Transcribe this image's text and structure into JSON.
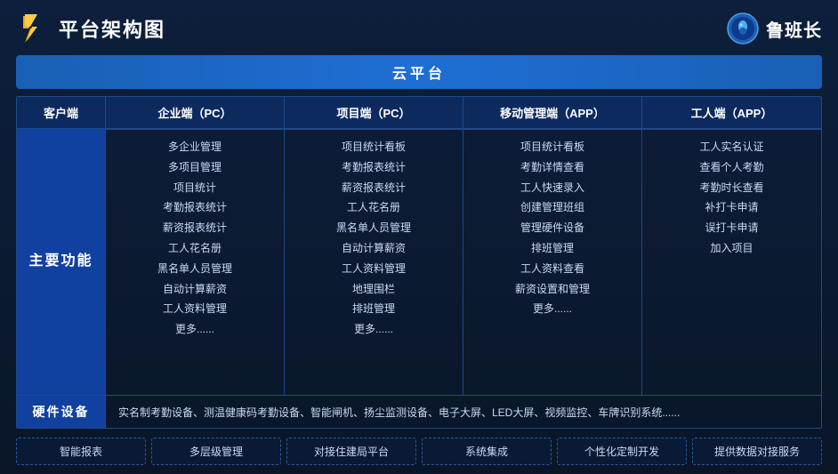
{
  "header": {
    "title": "平台架构图",
    "brand_name": "鲁班长"
  },
  "cloud_bar": "云平台",
  "columns": {
    "client": "客户端",
    "enterprise": "企业端（PC）",
    "project_pc": "项目端（PC）",
    "mobile_app": "移动管理端（APP）",
    "worker_app": "工人端（APP）"
  },
  "row_label": "主要功能",
  "enterprise_features": [
    "多企业管理",
    "多项目管理",
    "项目统计",
    "考勤报表统计",
    "薪资报表统计",
    "工人花名册",
    "黑名单人员管理",
    "自动计算薪资",
    "工人资料管理",
    "更多......"
  ],
  "project_features": [
    "项目统计看板",
    "考勤报表统计",
    "薪资报表统计",
    "工人花名册",
    "黑名单人员管理",
    "自动计算薪资",
    "工人资料管理",
    "地理围栏",
    "排班管理",
    "更多......"
  ],
  "mobile_features": [
    "项目统计看板",
    "考勤详情查看",
    "工人快速录入",
    "创建管理班组",
    "管理硬件设备",
    "排班管理",
    "工人资料查看",
    "薪资设置和管理",
    "更多......"
  ],
  "worker_features": [
    "工人实名认证",
    "查看个人考勤",
    "考勤时长查看",
    "补打卡申请",
    "误打卡申请",
    "加入项目"
  ],
  "hardware": {
    "label": "硬件设备",
    "content": "实名制考勤设备、测温健康码考勤设备、智能闸机、扬尘监测设备、电子大屏、LED大屏、视频监控、车牌识别系统......"
  },
  "bottom_features": [
    "智能报表",
    "多层级管理",
    "对接住建局平台",
    "系统集成",
    "个性化定制开发",
    "提供数据对接服务"
  ]
}
